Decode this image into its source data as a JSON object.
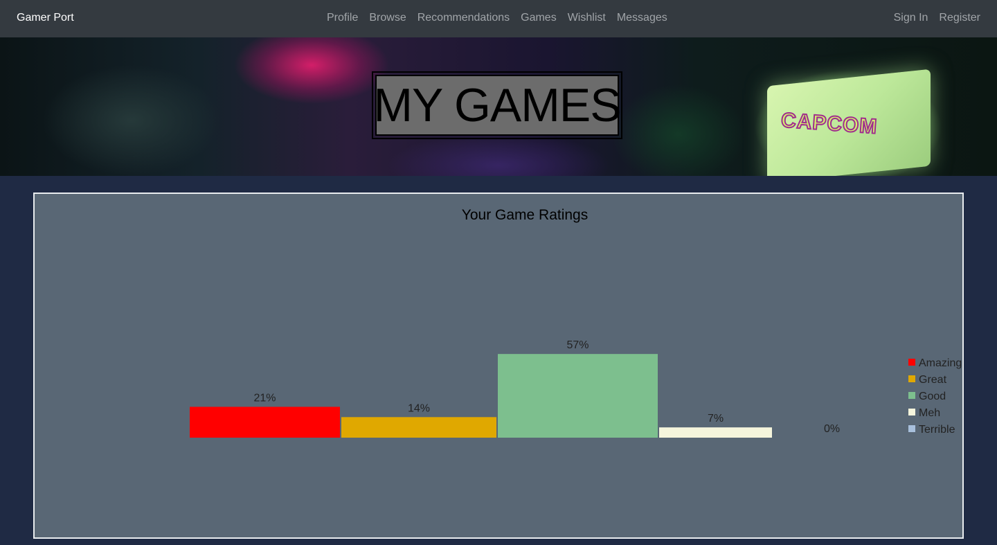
{
  "navbar": {
    "brand": "Gamer Port",
    "links": [
      {
        "label": "Profile"
      },
      {
        "label": "Browse"
      },
      {
        "label": "Recommendations"
      },
      {
        "label": "Games"
      },
      {
        "label": "Wishlist"
      },
      {
        "label": "Messages"
      }
    ],
    "auth": [
      {
        "label": "Sign In"
      },
      {
        "label": "Register"
      }
    ]
  },
  "hero": {
    "title": "MY GAMES",
    "image_text": "CAPCOM"
  },
  "chart_data": {
    "type": "bar",
    "title": "Your Game Ratings",
    "categories": [
      "Amazing",
      "Great",
      "Good",
      "Meh",
      "Terrible"
    ],
    "values": [
      21,
      14,
      57,
      7,
      0
    ],
    "value_labels": [
      "21%",
      "14%",
      "57%",
      "7%",
      "0%"
    ],
    "colors": [
      "#ff0000",
      "#e0a800",
      "#7dbf8e",
      "#f5f5dc",
      "#a8c0dc"
    ],
    "legend_position": "right",
    "grid": false,
    "xlabel": "",
    "ylabel": ""
  }
}
